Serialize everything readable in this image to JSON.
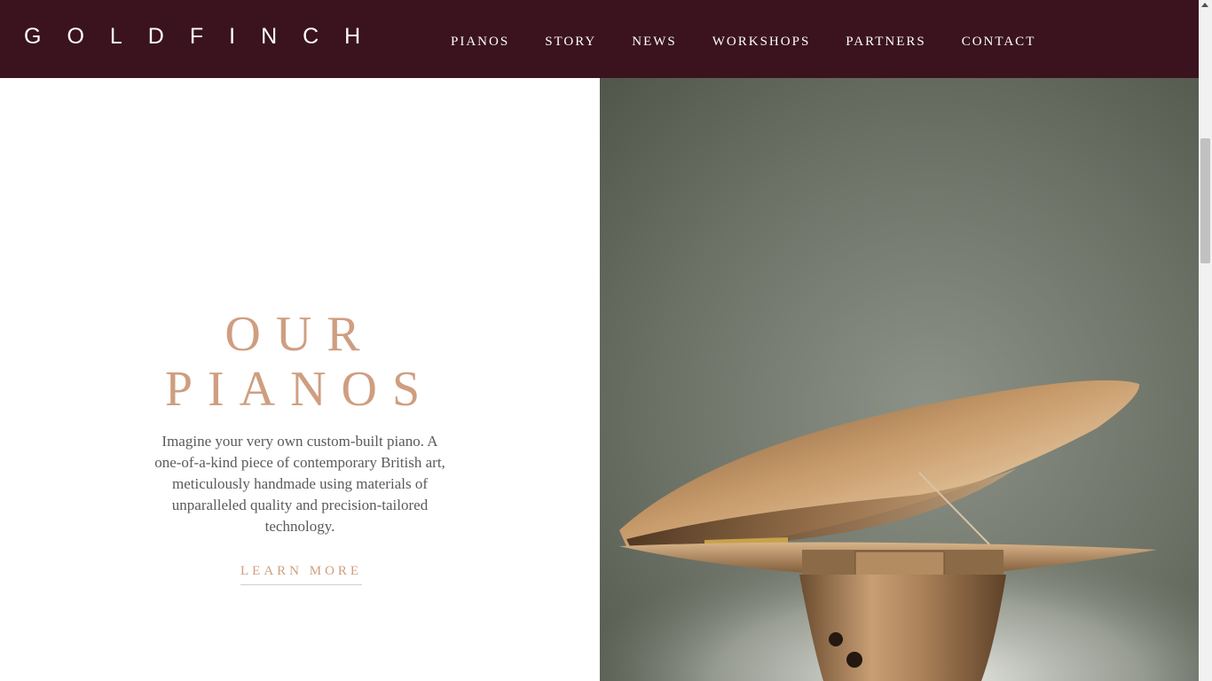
{
  "brand": {
    "logo_text": "GOLDFINCH"
  },
  "nav": {
    "items": [
      {
        "label": "PIANOS"
      },
      {
        "label": "STORY"
      },
      {
        "label": "NEWS"
      },
      {
        "label": "WORKSHOPS"
      },
      {
        "label": "PARTNERS"
      },
      {
        "label": "CONTACT"
      }
    ]
  },
  "hero": {
    "title_line1": "OUR",
    "title_line2": "PIANOS",
    "description": "Imagine your very own custom-built piano. A one-of-a-kind piece of contemporary British art, meticulously handmade using materials of unparalleled quality and precision-tailored technology.",
    "cta_label": "LEARN MORE",
    "image_subject": "bronze grand piano with open lid"
  },
  "colors": {
    "header_bg": "#3a131e",
    "accent": "#cf9e80",
    "body_text": "#5a5a5a"
  }
}
